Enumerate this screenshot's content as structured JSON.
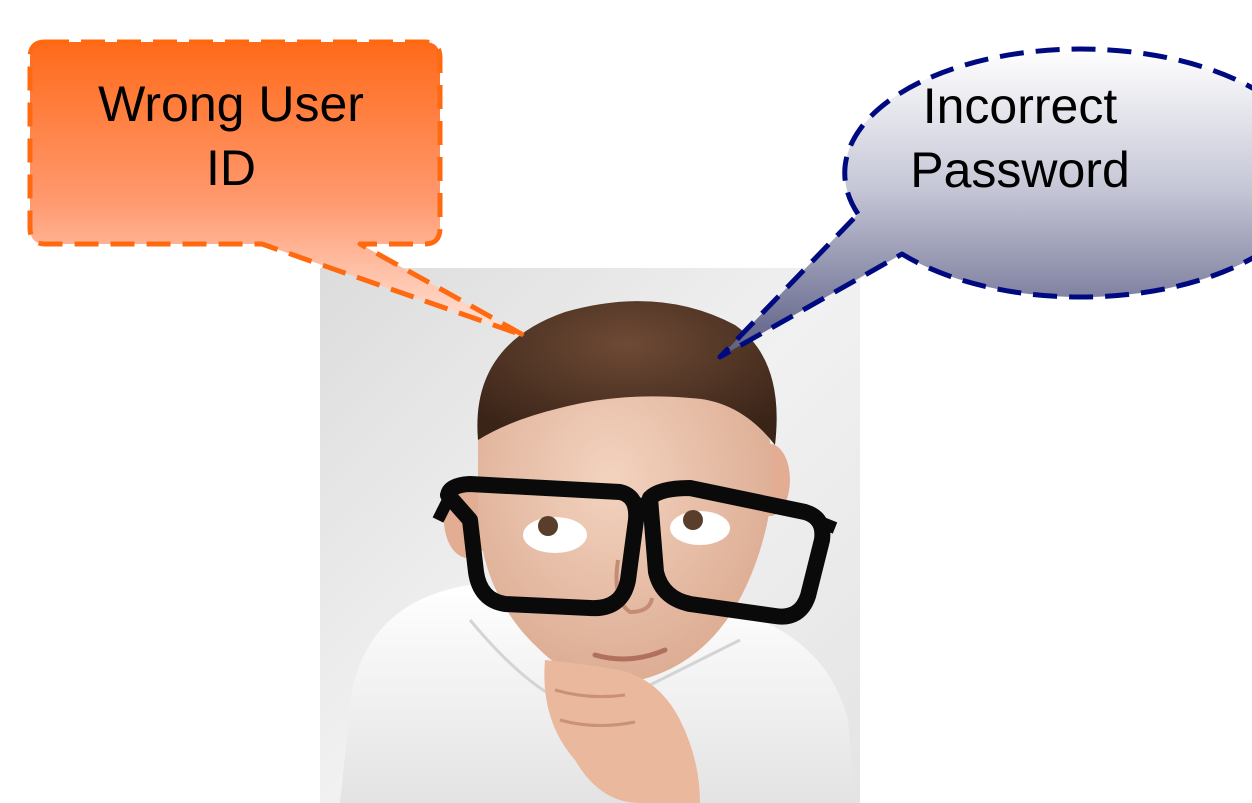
{
  "photo": {
    "subject": "boy-with-glasses-thinking"
  },
  "callout_left": {
    "line1": "Wrong User",
    "line2": "ID",
    "border_color": "#ff6a10",
    "fill_top": "#ff6a1a",
    "fill_bottom": "#ffe6dc"
  },
  "callout_right": {
    "line1": "Incorrect",
    "line2": "Password",
    "border_color": "#000a80",
    "fill_top": "#ffffff",
    "fill_bottom": "#6a6c90"
  }
}
